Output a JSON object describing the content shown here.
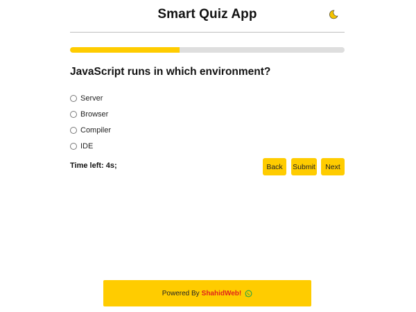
{
  "header": {
    "title": "Smart Quiz App",
    "theme_icon": "moon-icon"
  },
  "progress": {
    "fraction": 0.4
  },
  "question": {
    "text": "JavaScript runs in which environment?",
    "options": [
      "Server",
      "Browser",
      "Compiler",
      "IDE"
    ]
  },
  "timer": {
    "text": "Time left: 4s;"
  },
  "buttons": {
    "back": "Back",
    "submit": "Submit",
    "next": "Next"
  },
  "footer": {
    "prefix": "Powered By",
    "brand": "ShahidWeb!",
    "icon": "whatsapp-icon"
  },
  "colors": {
    "accent": "#ffcc00",
    "brand": "#e0251b",
    "track": "#dedede"
  }
}
